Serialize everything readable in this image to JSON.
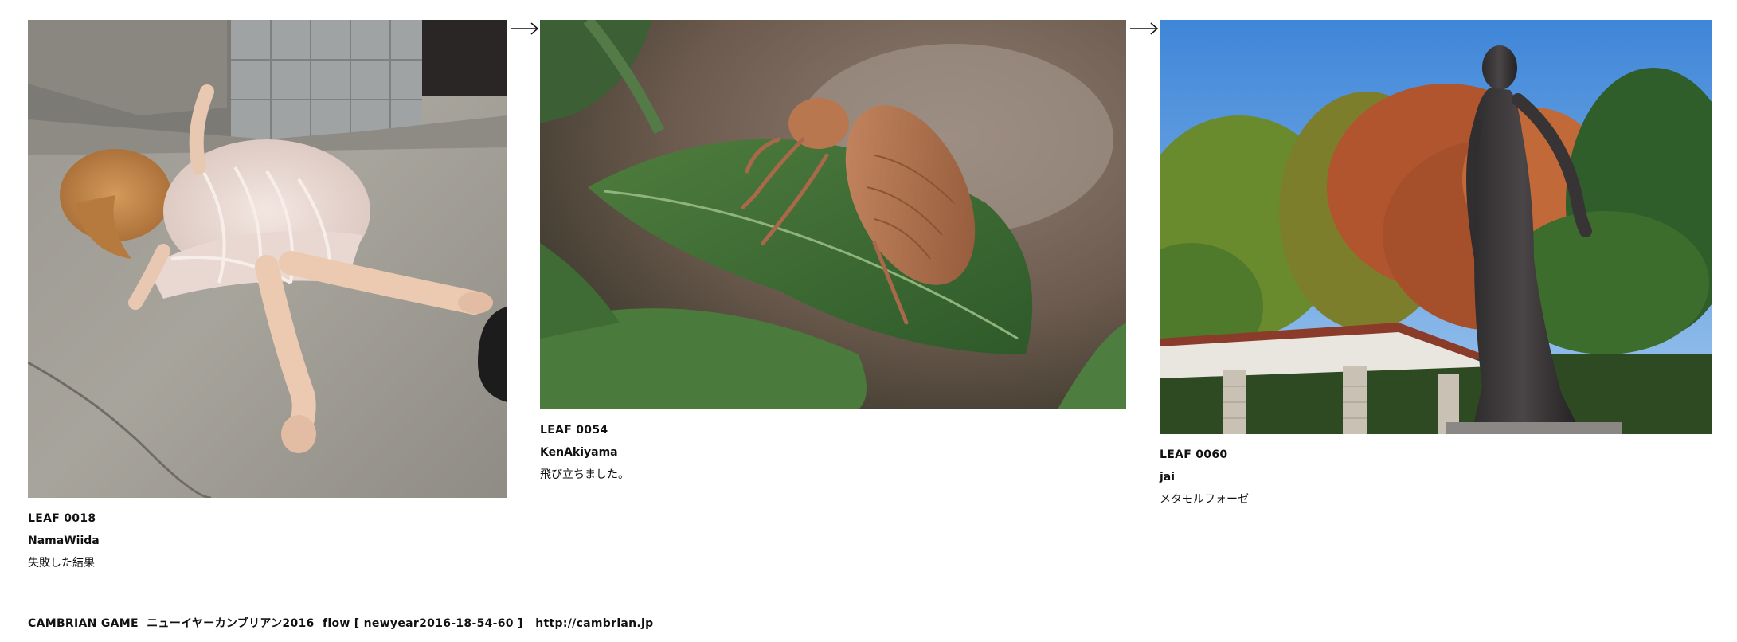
{
  "leaves": [
    {
      "id": "LEAF 0018",
      "author": "NamaWiida",
      "title": "失敗した結果",
      "image": "doll-lying-on-concrete-photo"
    },
    {
      "id": "LEAF 0054",
      "author": "KenAkiyama",
      "title": "飛び立ちました。",
      "image": "cicada-shell-on-leaf-photo"
    },
    {
      "id": "LEAF 0060",
      "author": "jai",
      "title": "メタモルフォーゼ",
      "image": "bronze-statue-in-park-photo"
    }
  ],
  "arrows": [
    "arrow-right-icon",
    "arrow-right-icon"
  ],
  "footer": {
    "site": "CAMBRIAN GAME",
    "event": "ニューイヤーカンブリアン2016",
    "flow": "flow [ newyear2016-18-54-60 ]",
    "url": "http://cambrian.jp"
  }
}
